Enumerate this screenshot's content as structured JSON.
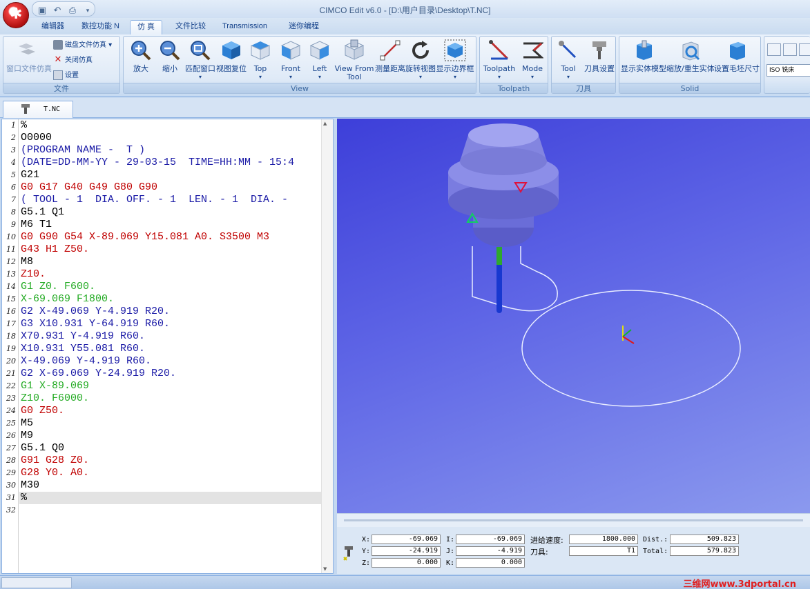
{
  "window": {
    "title": "CIMCO Edit v6.0 - [D:\\用户目录\\Desktop\\T.NC]"
  },
  "tabs": [
    {
      "label": "编辑器"
    },
    {
      "label": "数控功能 N"
    },
    {
      "label": "仿 真"
    },
    {
      "label": "文件比较"
    },
    {
      "label": "Transmission"
    },
    {
      "label": "迷你编程"
    }
  ],
  "ribbon": {
    "file_group": {
      "label": "文件",
      "window_sim": "窗口文件仿真",
      "disk_sim": "磁盘文件仿真",
      "close_sim": "关闭仿真",
      "settings": "设置"
    },
    "view_group": {
      "label": "View",
      "buttons": [
        "放大",
        "缩小",
        "匹配窗口",
        "视图复位",
        "Top",
        "Front",
        "Left",
        "View From Tool",
        "测量距离",
        "旋转视图",
        "显示边界框"
      ]
    },
    "toolpath_group": {
      "label": "Toolpath",
      "buttons": [
        "Toolpath",
        "Mode"
      ]
    },
    "tool_group": {
      "label": "刀具",
      "buttons": [
        "Tool",
        "刀具设置"
      ]
    },
    "solid_group": {
      "label": "Solid",
      "buttons": [
        "显示实体模型",
        "缩放/重生实体",
        "设置毛坯尺寸"
      ]
    },
    "iso_combo": "ISO 铣床"
  },
  "document_tab": "T.NC",
  "code_lines": [
    {
      "n": "1",
      "text": "%",
      "color": "#000000"
    },
    {
      "n": "2",
      "text": "O0000",
      "color": "#000000"
    },
    {
      "n": "3",
      "text": "(PROGRAM NAME -  T )",
      "color": "#1a1aa6"
    },
    {
      "n": "4",
      "text": "(DATE=DD-MM-YY - 29-03-15  TIME=HH:MM - 15:4",
      "color": "#1a1aa6"
    },
    {
      "n": "5",
      "text": "G21",
      "color": "#000000"
    },
    {
      "n": "6",
      "text": "G0 G17 G40 G49 G80 G90",
      "color": "#c00000"
    },
    {
      "n": "7",
      "text": "( TOOL - 1  DIA. OFF. - 1  LEN. - 1  DIA. -",
      "color": "#1a1aa6"
    },
    {
      "n": "8",
      "text": "G5.1 Q1",
      "color": "#000000"
    },
    {
      "n": "9",
      "text": "M6 T1",
      "color": "#000000"
    },
    {
      "n": "10",
      "text": "G0 G90 G54 X-89.069 Y15.081 A0. S3500 M3",
      "color": "#c00000"
    },
    {
      "n": "11",
      "text": "G43 H1 Z50.",
      "color": "#c00000"
    },
    {
      "n": "12",
      "text": "M8",
      "color": "#000000"
    },
    {
      "n": "13",
      "text": "Z10.",
      "color": "#c00000"
    },
    {
      "n": "14",
      "text": "G1 Z0. F600.",
      "color": "#22aa22"
    },
    {
      "n": "15",
      "text": "X-69.069 F1800.",
      "color": "#22aa22"
    },
    {
      "n": "16",
      "text": "G2 X-49.069 Y-4.919 R20.",
      "color": "#1a1aa6"
    },
    {
      "n": "17",
      "text": "G3 X10.931 Y-64.919 R60.",
      "color": "#1a1aa6"
    },
    {
      "n": "18",
      "text": "X70.931 Y-4.919 R60.",
      "color": "#1a1aa6"
    },
    {
      "n": "19",
      "text": "X10.931 Y55.081 R60.",
      "color": "#1a1aa6"
    },
    {
      "n": "20",
      "text": "X-49.069 Y-4.919 R60.",
      "color": "#1a1aa6"
    },
    {
      "n": "21",
      "text": "G2 X-69.069 Y-24.919 R20.",
      "color": "#1a1aa6"
    },
    {
      "n": "22",
      "text": "G1 X-89.069",
      "color": "#22aa22"
    },
    {
      "n": "23",
      "text": "Z10. F6000.",
      "color": "#22aa22"
    },
    {
      "n": "24",
      "text": "G0 Z50.",
      "color": "#c00000"
    },
    {
      "n": "25",
      "text": "M5",
      "color": "#000000"
    },
    {
      "n": "26",
      "text": "M9",
      "color": "#000000"
    },
    {
      "n": "27",
      "text": "G5.1 Q0",
      "color": "#000000"
    },
    {
      "n": "28",
      "text": "G91 G28 Z0.",
      "color": "#c00000"
    },
    {
      "n": "29",
      "text": "G28 Y0. A0.",
      "color": "#c00000"
    },
    {
      "n": "30",
      "text": "M30",
      "color": "#000000"
    },
    {
      "n": "31",
      "text": "%",
      "color": "#000000"
    },
    {
      "n": "32",
      "text": "",
      "color": "#000000"
    }
  ],
  "status": {
    "x_label": "X:",
    "x_value": "-69.069",
    "y_label": "Y:",
    "y_value": "-24.919",
    "z_label": "Z:",
    "z_value": "0.000",
    "i_label": "I:",
    "i_value": "-69.069",
    "j_label": "J:",
    "j_value": "-4.919",
    "k_label": "K:",
    "k_value": "0.000",
    "feed_label": "进给速度:",
    "feed_value": "1800.000",
    "tool_label": "刀具:",
    "tool_value": "T1",
    "dist_label": "Dist.:",
    "dist_value": "509.823",
    "total_label": "Total:",
    "total_value": "579.823"
  },
  "watermark": "三维网www.3dportal.cn"
}
